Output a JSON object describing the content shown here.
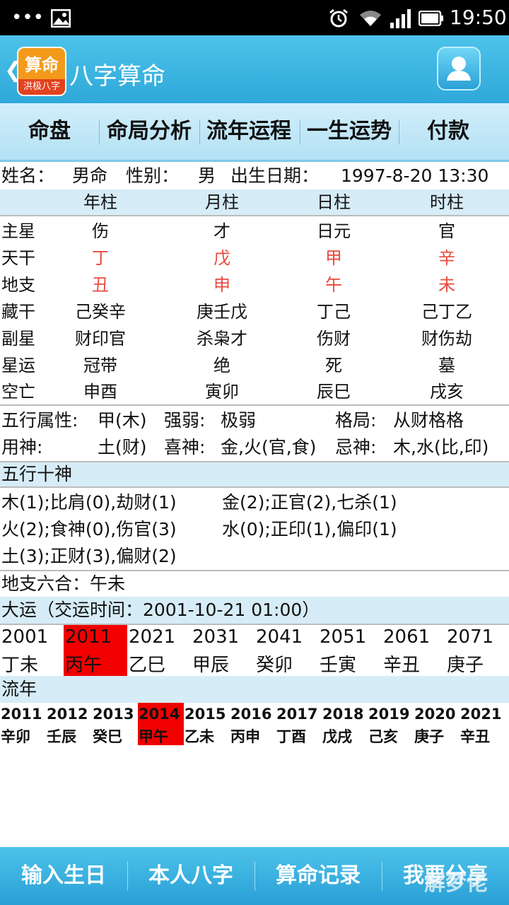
{
  "status_bar": {
    "dots": "•••",
    "time": "19:50"
  },
  "header": {
    "back": "❮",
    "logo_top": "算命",
    "logo_bottom": "洪极八字",
    "title": "八字算命"
  },
  "tabs": [
    "命盘",
    "命局分析",
    "流年运程",
    "一生运势",
    "付款"
  ],
  "info": {
    "name_label": "姓名：",
    "name_value": "男命",
    "gender_label": "性别：",
    "gender_value": "男",
    "birth_label": "出生日期：",
    "birth_value": "1997-8-20 13:30"
  },
  "pillars": {
    "headers": [
      "年柱",
      "月柱",
      "日柱",
      "时柱"
    ],
    "rows": [
      {
        "label": "主星",
        "cells": [
          "伤",
          "才",
          "日元",
          "官"
        ]
      },
      {
        "label": "天干",
        "cells": [
          "丁",
          "戊",
          "甲",
          "辛"
        ]
      },
      {
        "label": "地支",
        "cells": [
          "丑",
          "申",
          "午",
          "未"
        ]
      },
      {
        "label": "藏干",
        "cells": [
          "己癸辛",
          "庚壬戊",
          "丁己",
          "己丁乙"
        ]
      },
      {
        "label": "副星",
        "cells": [
          "财印官",
          "杀枭才",
          "伤财",
          "财伤劫"
        ]
      },
      {
        "label": "星运",
        "cells": [
          "冠带",
          "绝",
          "死",
          "墓"
        ]
      },
      {
        "label": "空亡",
        "cells": [
          "申酉",
          "寅卯",
          "辰巳",
          "戌亥"
        ]
      }
    ]
  },
  "attrs": {
    "wuxing_label": "五行属性:",
    "wuxing_value": "甲(木)",
    "strength_label": "强弱:",
    "strength_value": "极弱",
    "geju_label": "格局:",
    "geju_value": "从财格格",
    "yongshen_label": "用神:",
    "yongshen_value": "土(财)",
    "xishen_label": "喜神:",
    "xishen_value": "金,火(官,食)",
    "jishen_label": "忌神:",
    "jishen_value": "木,水(比,印)"
  },
  "shishen": {
    "title": "五行十神",
    "left": [
      "木(1);比肩(0),劫财(1)",
      "火(2);食神(0),伤官(3)",
      "土(3);正财(3),偏财(2)"
    ],
    "right": [
      "金(2);正官(2),七杀(1)",
      "水(0);正印(1),偏印(1)"
    ]
  },
  "liuhe": "地支六合：午未",
  "dayun": {
    "title": "大运（交运时间：2001-10-21 01:00）",
    "items": [
      {
        "year": "2001",
        "gz": "丁未"
      },
      {
        "year": "2011",
        "gz": "丙午"
      },
      {
        "year": "2021",
        "gz": "乙巳"
      },
      {
        "year": "2031",
        "gz": "甲辰"
      },
      {
        "year": "2041",
        "gz": "癸卯"
      },
      {
        "year": "2051",
        "gz": "壬寅"
      },
      {
        "year": "2061",
        "gz": "辛丑"
      },
      {
        "year": "2071",
        "gz": "庚子"
      }
    ],
    "highlight_color": "#f20000"
  },
  "liunian": {
    "title": "流年",
    "items": [
      {
        "year": "2011",
        "gz": "辛卯"
      },
      {
        "year": "2012",
        "gz": "壬辰"
      },
      {
        "year": "2013",
        "gz": "癸巳"
      },
      {
        "year": "2014",
        "gz": "甲午"
      },
      {
        "year": "2015",
        "gz": "乙未"
      },
      {
        "year": "2016",
        "gz": "丙申"
      },
      {
        "year": "2017",
        "gz": "丁酉"
      },
      {
        "year": "2018",
        "gz": "戊戌"
      },
      {
        "year": "2019",
        "gz": "己亥"
      },
      {
        "year": "2020",
        "gz": "庚子"
      },
      {
        "year": "2021",
        "gz": "辛丑"
      }
    ]
  },
  "bottom_tabs": [
    "输入生日",
    "本人八字",
    "算命记录",
    "我要分享"
  ],
  "watermark": "解梦佬",
  "colors": {
    "accent": "#2fa8d9",
    "ganzhi_red": "#e84a3e",
    "highlight": "#f20000"
  }
}
